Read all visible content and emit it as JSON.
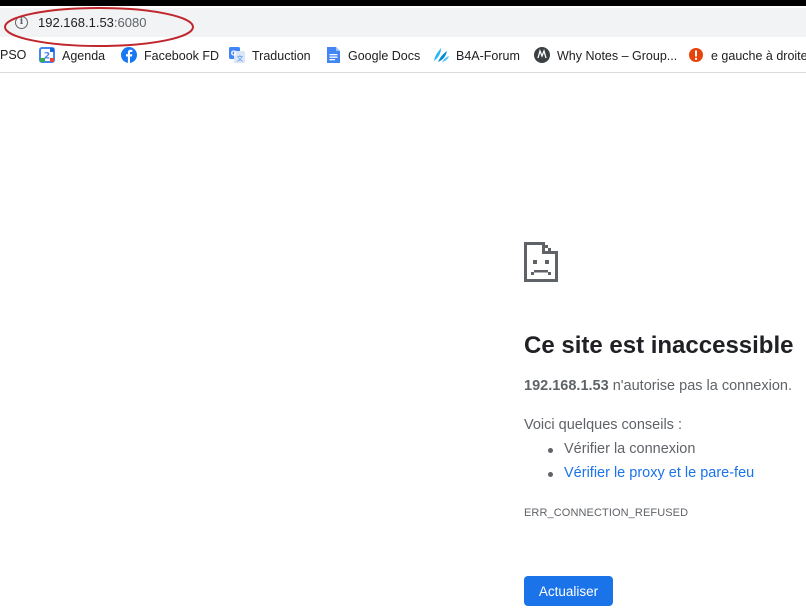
{
  "address_bar": {
    "host": "192.168.1.53",
    "port": ":6080"
  },
  "bookmarks": [
    {
      "label": "PSO",
      "icon": "none"
    },
    {
      "label": "Agenda",
      "icon": "calendar-icon",
      "icon_text": "2"
    },
    {
      "label": "Facebook FD",
      "icon": "facebook-icon"
    },
    {
      "label": "Traduction",
      "icon": "translate-icon"
    },
    {
      "label": "Google Docs",
      "icon": "docs-icon"
    },
    {
      "label": "B4A-Forum",
      "icon": "b4a-icon"
    },
    {
      "label": "Why Notes – Group...",
      "icon": "whynotes-icon"
    },
    {
      "label": "e gauche à droite",
      "icon": "alert-icon"
    }
  ],
  "error_page": {
    "title": "Ce site est inaccessible",
    "host": "192.168.1.53",
    "message": " n'autorise pas la connexion.",
    "suggestions_title": "Voici quelques conseils :",
    "suggestions": [
      {
        "text": "Vérifier la connexion",
        "is_link": false
      },
      {
        "text": "Vérifier le proxy et le pare-feu",
        "is_link": true
      }
    ],
    "error_code": "ERR_CONNECTION_REFUSED",
    "reload_label": "Actualiser"
  },
  "colors": {
    "link": "#1a73e8",
    "button": "#1a73e8",
    "annotation": "#c0262c"
  }
}
